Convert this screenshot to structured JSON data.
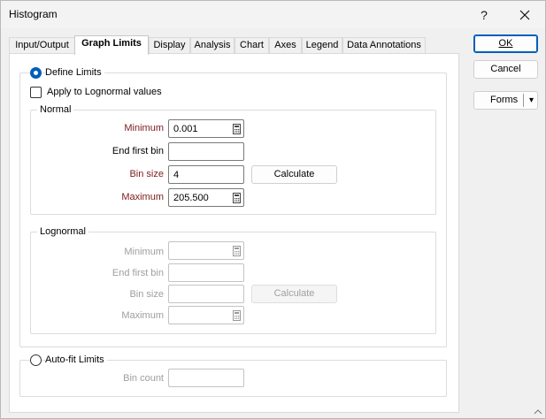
{
  "window": {
    "title": "Histogram",
    "help": "?",
    "close": "✕"
  },
  "tabs": [
    {
      "label": "Input/Output",
      "active": false
    },
    {
      "label": "Graph Limits",
      "active": true
    },
    {
      "label": "Display",
      "active": false
    },
    {
      "label": "Analysis",
      "active": false
    },
    {
      "label": "Chart",
      "active": false
    },
    {
      "label": "Axes",
      "active": false
    },
    {
      "label": "Legend",
      "active": false
    },
    {
      "label": "Data Annotations",
      "active": false
    }
  ],
  "define_limits": {
    "label": "Define Limits",
    "selected": true,
    "apply_lognormal": {
      "label": "Apply to Lognormal values",
      "checked": false
    },
    "normal": {
      "title": "Normal",
      "minimum": {
        "label": "Minimum",
        "value": "0.001"
      },
      "end_first_bin": {
        "label": "End first bin",
        "value": ""
      },
      "bin_size": {
        "label": "Bin size",
        "value": "4"
      },
      "maximum": {
        "label": "Maximum",
        "value": "205.500"
      },
      "calculate": "Calculate"
    },
    "lognormal": {
      "title": "Lognormal",
      "minimum": {
        "label": "Minimum",
        "value": ""
      },
      "end_first_bin": {
        "label": "End first bin",
        "value": ""
      },
      "bin_size": {
        "label": "Bin size",
        "value": ""
      },
      "maximum": {
        "label": "Maximum",
        "value": ""
      },
      "calculate": "Calculate"
    }
  },
  "auto_fit": {
    "label": "Auto-fit Limits",
    "selected": false,
    "bin_count": {
      "label": "Bin count",
      "value": ""
    }
  },
  "buttons": {
    "ok": "OK",
    "cancel": "Cancel",
    "forms": "Forms",
    "forms_arrow": "▾"
  },
  "colors": {
    "accent": "#005fb8",
    "required_label": "#7b1c1c",
    "disabled": "#9e9e9e"
  }
}
